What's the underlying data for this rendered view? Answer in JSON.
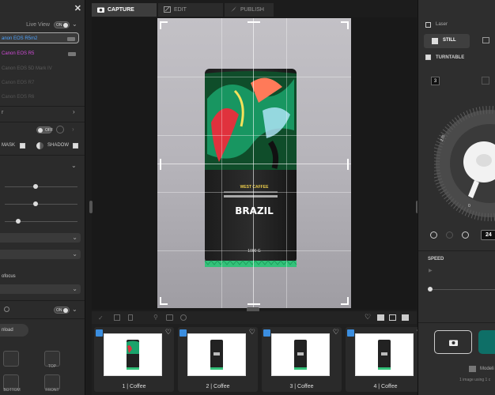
{
  "left_panel": {
    "live_view_label": "Live View",
    "live_view_toggle": "ON",
    "cameras": [
      {
        "label": "anon EOS R5m2",
        "color": "#4da3ff"
      },
      {
        "label": "Canon EOS R5",
        "color": "#d04bd8"
      },
      {
        "label": "Canon EOS 5D Mark IV",
        "color": "#6a6a6a"
      },
      {
        "label": "Canon EOS R7",
        "color": "#5c5c5c"
      },
      {
        "label": "Canon EOS R6",
        "color": "#5c5c5c"
      }
    ],
    "section_arrow_label": "r",
    "off_toggle": "OFF",
    "mask_label": "MASK",
    "shadow_label": "SHADOW",
    "autofocus_label": "ofocus",
    "on_toggle_bottom": "ON",
    "download_label": "nload",
    "views": [
      {
        "label": "",
        "id": "left"
      },
      {
        "label": "TOP",
        "id": "top"
      },
      {
        "label": "BOTTOM",
        "id": "bottom"
      },
      {
        "label": "FRONT",
        "id": "front"
      }
    ]
  },
  "tabs": [
    {
      "label": "CAPTURE",
      "icon": "camera-icon",
      "active": true
    },
    {
      "label": "EDIT",
      "icon": "edit-icon",
      "active": false
    },
    {
      "label": "PUBLISH",
      "icon": "rocket-icon",
      "active": false
    }
  ],
  "product": {
    "brand": "WEST CAFFEE",
    "name": "BRAZIL",
    "weight": "1000 G"
  },
  "filmstrip": {
    "thumbs": [
      {
        "caption": "1 | Coffee"
      },
      {
        "caption": "2 | Coffee"
      },
      {
        "caption": "3 | Coffee"
      },
      {
        "caption": "4 | Coffee"
      }
    ]
  },
  "right_panel": {
    "laser_label": "Laser",
    "still_label": "STILL",
    "turntable_label": "TURNTABLE",
    "step_value": "3",
    "dial_values": [
      "270",
      "0"
    ],
    "angle_value": "24",
    "speed_label": "SPEED",
    "model_label": "Modeli",
    "footer_text": "1 image using 1 c"
  },
  "colors": {
    "accent_blue": "#3b8ee0",
    "accent_teal": "#0e6f67",
    "panel_bg": "#2b2b2b"
  }
}
